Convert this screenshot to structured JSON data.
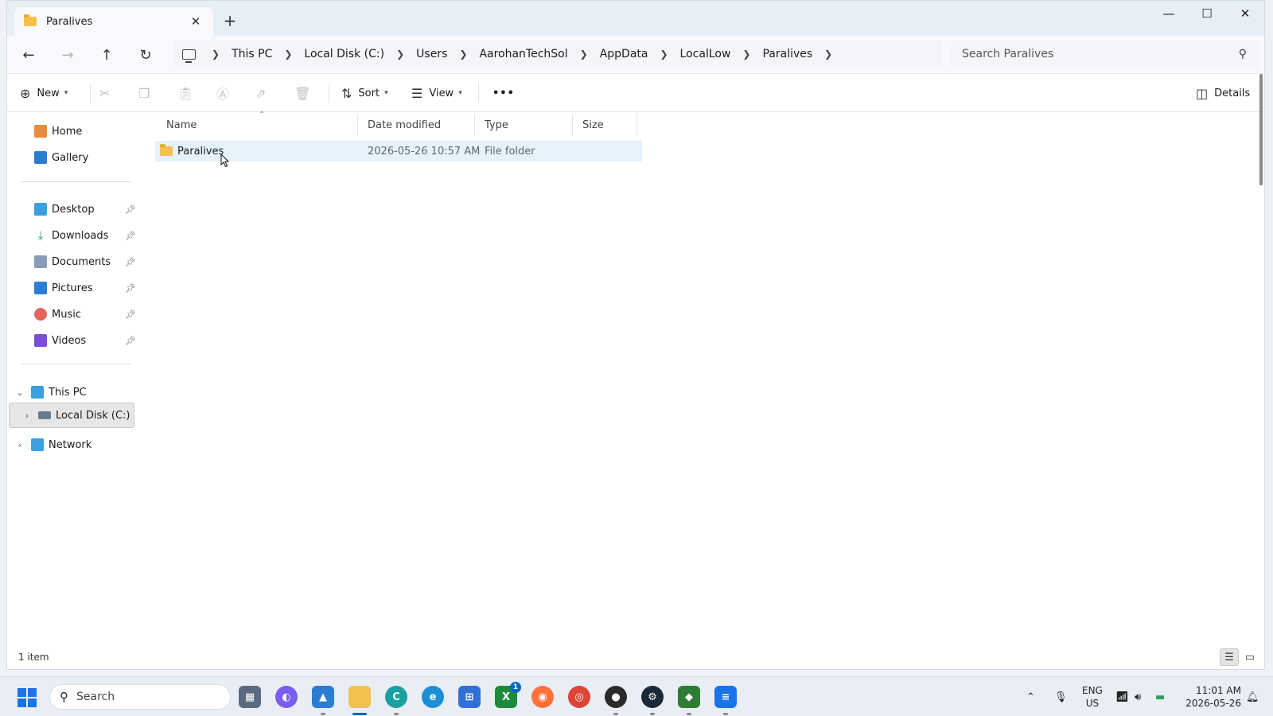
{
  "window": {
    "tab_title": "Paralives",
    "controls": {
      "minimize": "—",
      "maximize": "☐",
      "close": "✕"
    }
  },
  "breadcrumb": [
    "This PC",
    "Local Disk (C:)",
    "Users",
    "AarohanTechSol",
    "AppData",
    "LocalLow",
    "Paralives"
  ],
  "search": {
    "placeholder": "Search Paralives"
  },
  "commands": {
    "new": "New",
    "sort": "Sort",
    "view": "View",
    "more": "•••",
    "details": "Details"
  },
  "nav": {
    "quick": [
      {
        "label": "Home",
        "icon": "home-icon",
        "color": "#e98a3c"
      },
      {
        "label": "Gallery",
        "icon": "gallery-icon",
        "color": "#2b7cd3"
      }
    ],
    "pinned": [
      {
        "label": "Desktop",
        "icon": "desktop-icon",
        "color": "#3aa0e0"
      },
      {
        "label": "Downloads",
        "icon": "downloads-icon",
        "color": "#2e9d5a"
      },
      {
        "label": "Documents",
        "icon": "documents-icon",
        "color": "#8a9bb5"
      },
      {
        "label": "Pictures",
        "icon": "pictures-icon",
        "color": "#2b7cd3"
      },
      {
        "label": "Music",
        "icon": "music-icon",
        "color": "#e2665a"
      },
      {
        "label": "Videos",
        "icon": "videos-icon",
        "color": "#7a4fd6"
      }
    ],
    "tree": {
      "this_pc": "This PC",
      "local_disk": "Local Disk (C:)",
      "network": "Network"
    }
  },
  "columns": {
    "name": "Name",
    "date": "Date modified",
    "type": "Type",
    "size": "Size"
  },
  "files": [
    {
      "name": "Paralives",
      "date": "2026-05-26 10:57 AM",
      "type": "File folder",
      "size": ""
    }
  ],
  "status": {
    "count": "1 item"
  },
  "taskbar": {
    "search_label": "Search",
    "lang_top": "ENG",
    "lang_bottom": "US",
    "time": "11:01 AM",
    "date": "2026-05-26",
    "badge": "1"
  },
  "colors": {
    "accent": "#0067c0",
    "folder": "#f2c14e",
    "selection": "#e5f1fb"
  }
}
